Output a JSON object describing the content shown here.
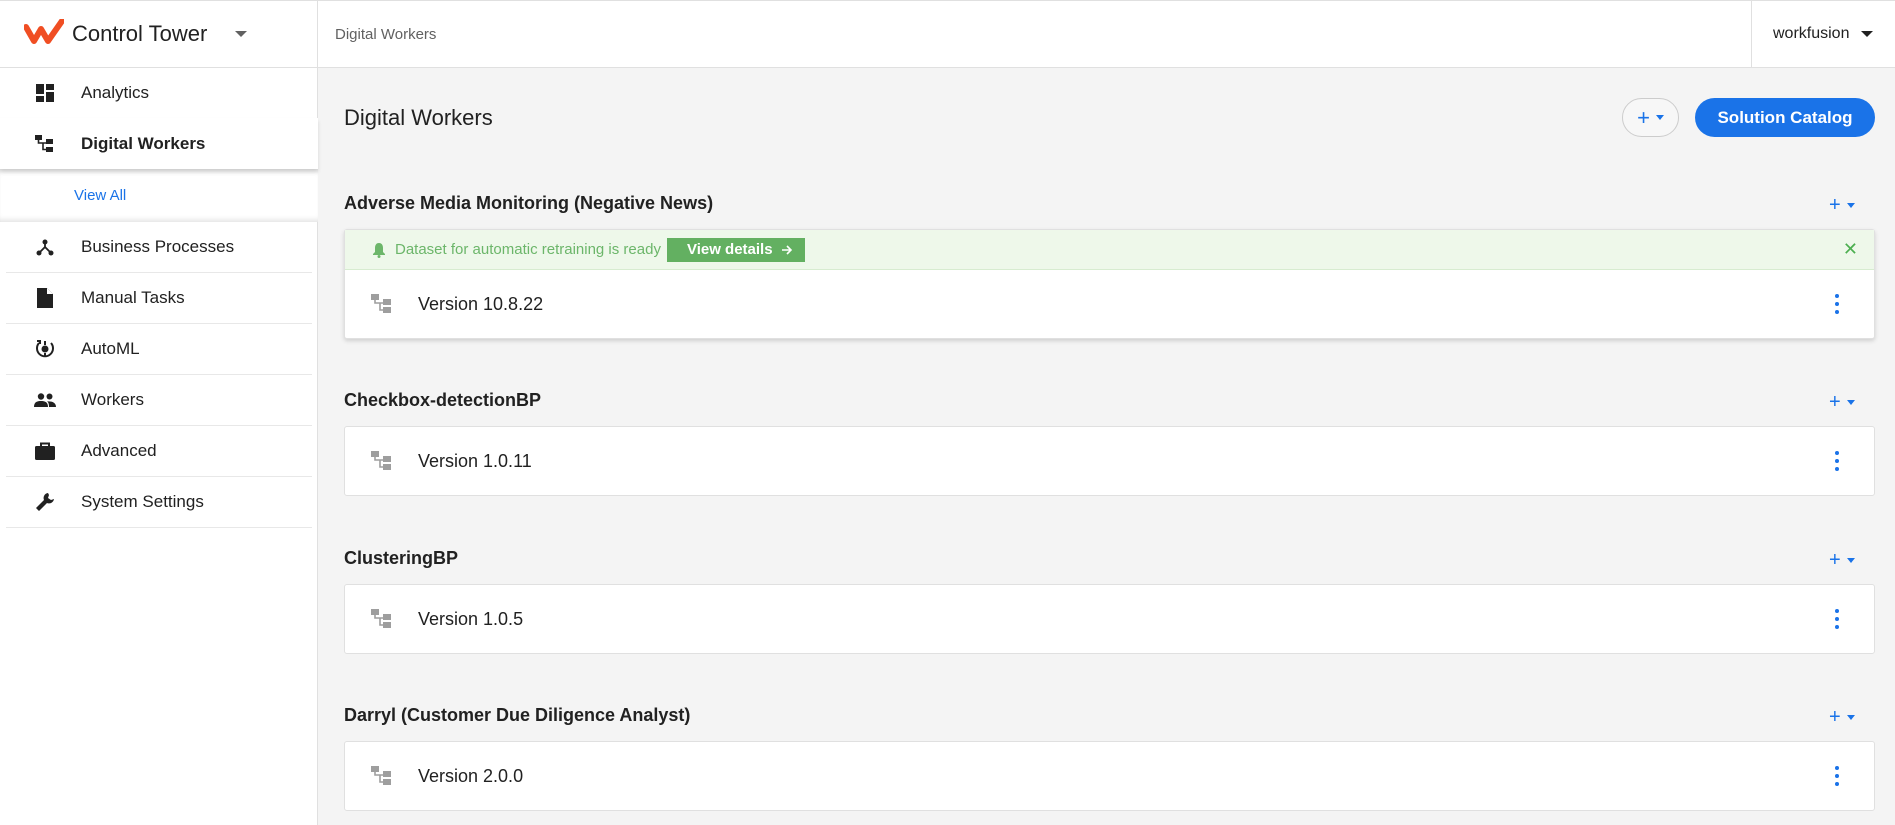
{
  "header": {
    "app_title": "Control Tower",
    "breadcrumb": "Digital Workers",
    "user": "workfusion"
  },
  "colors": {
    "accent": "#1a73e8",
    "brand": "#f04e23",
    "success": "#63b061"
  },
  "sidebar": {
    "items": [
      {
        "label": "Analytics",
        "icon": "dashboard-icon"
      },
      {
        "label": "Digital Workers",
        "icon": "digital-workers-icon",
        "active": true
      },
      {
        "label": "Business Processes",
        "icon": "process-icon"
      },
      {
        "label": "Manual Tasks",
        "icon": "document-icon"
      },
      {
        "label": "AutoML",
        "icon": "automl-icon"
      },
      {
        "label": "Workers",
        "icon": "people-icon"
      },
      {
        "label": "Advanced",
        "icon": "briefcase-icon"
      },
      {
        "label": "System Settings",
        "icon": "wrench-icon"
      }
    ],
    "sub": {
      "view_all": "View All"
    }
  },
  "main": {
    "title": "Digital Workers",
    "add_label": "+",
    "catalog_label": "Solution Catalog",
    "groups": [
      {
        "title": "Adverse Media Monitoring (Negative News)",
        "alert": {
          "message": "Dataset for automatic retraining is ready",
          "action": "View details"
        },
        "version": "Version 10.8.22"
      },
      {
        "title": "Checkbox-detectionBP",
        "version": "Version 1.0.11"
      },
      {
        "title": "ClusteringBP",
        "version": "Version 1.0.5"
      },
      {
        "title": "Darryl (Customer Due Diligence Analyst)",
        "version": "Version 2.0.0"
      }
    ]
  }
}
